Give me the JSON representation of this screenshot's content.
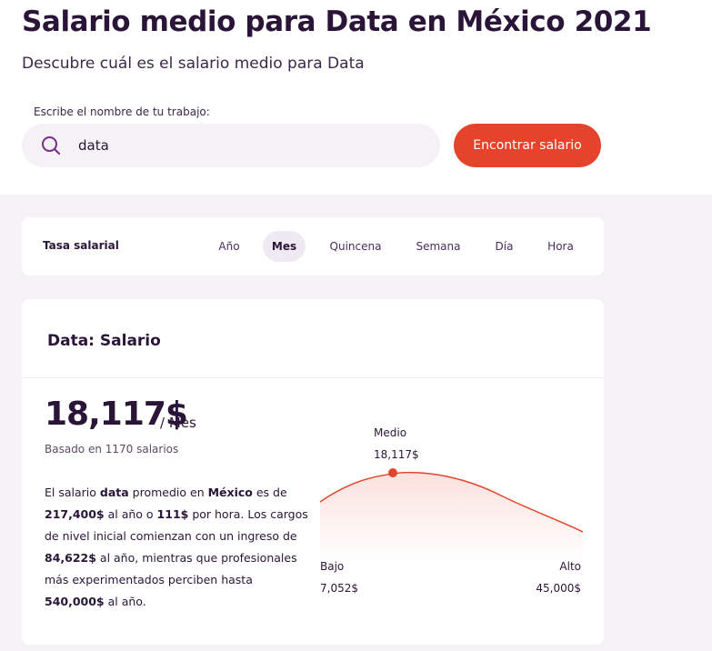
{
  "header": {
    "title": "Salario medio para Data en México 2021",
    "subtitle": "Descubre cuál es el salario medio para Data"
  },
  "search": {
    "label": "Escribe el nombre de tu trabajo:",
    "value": "data",
    "button_label": "Encontrar salario",
    "icon": "search-icon"
  },
  "rate": {
    "title": "Tasa salarial",
    "tabs": [
      "Año",
      "Mes",
      "Quincena",
      "Semana",
      "Día",
      "Hora"
    ],
    "active": "Mes"
  },
  "salary_card": {
    "heading": "Data: Salario",
    "amount": "18,117$",
    "unit": "/ Mes",
    "based_on": "Basado en 1170 salarios",
    "desc": {
      "p1": "El salario ",
      "b1": "data",
      "p2": " promedio en ",
      "b2": "México",
      "p3": " es de ",
      "b3": "217,400$",
      "p4": " al año o ",
      "b4": "111$",
      "p5": " por hora. Los cargos de nivel inicial comienzan con un ingreso de ",
      "b5": "84,622$",
      "p6": " al año, mientras que profesionales más experimentados perciben hasta ",
      "b6": "540,000$",
      "p7": " al año."
    }
  },
  "distribution": {
    "median_label": "Medio",
    "median_value": "18,117$",
    "low_label": "Bajo",
    "low_value": "7,052$",
    "high_label": "Alto",
    "high_value": "45,000$",
    "curve_color": "#e3442b"
  }
}
